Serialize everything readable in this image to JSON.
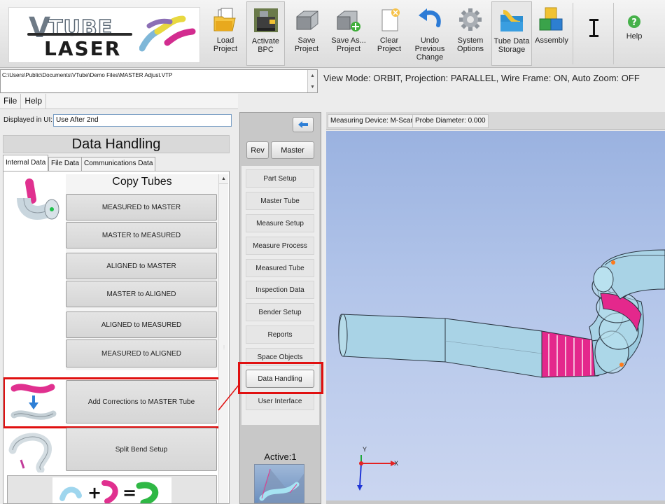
{
  "toolbar": {
    "logo": "VTUBE LASER",
    "buttons": [
      {
        "label": "Load Project",
        "icon": "folder-open-icon"
      },
      {
        "label": "Activate BPC",
        "icon": "bender-machine-icon"
      },
      {
        "label": "Save Project",
        "icon": "save-disk-icon"
      },
      {
        "label": "Save As... Project",
        "icon": "save-as-icon"
      },
      {
        "label": "Clear Project",
        "icon": "clear-document-icon"
      },
      {
        "label": "Undo Previous Change",
        "icon": "undo-arrow-icon"
      },
      {
        "label": "System Options",
        "icon": "gear-icon"
      },
      {
        "label": "Tube Data Storage",
        "icon": "tube-folder-icon"
      },
      {
        "label": "Assembly",
        "icon": "cubes-icon"
      },
      {
        "label": "",
        "icon": "text-cursor-icon"
      },
      {
        "label": "Help",
        "icon": "help-icon"
      }
    ]
  },
  "file_path": "C:\\Users\\Public\\Documents\\VTube\\Demo Files\\MASTER Adjust.VTP",
  "view_mode": "View Mode: ORBIT, Projection: PARALLEL, Wire Frame: ON, Auto Zoom: OFF",
  "menu": {
    "file": "File",
    "help": "Help"
  },
  "displayed_in_ui": {
    "label": "Displayed in UI:",
    "value": "Use After 2nd"
  },
  "panel": {
    "title": "Data Handling",
    "tabs": [
      "Internal Data",
      "File Data",
      "Communications Data"
    ],
    "copy_title": "Copy Tubes",
    "copy_buttons": [
      "MEASURED to MASTER",
      "MASTER to MEASURED",
      "ALIGNED to MASTER",
      "MASTER to ALIGNED",
      "ALIGNED to MEASURED",
      "MEASURED to ALIGNED"
    ],
    "add_corrections": "Add Corrections to MASTER Tube",
    "split_bend": "Split Bend Setup"
  },
  "nav": {
    "rev": "Rev",
    "master": "Master",
    "items": [
      "Part Setup",
      "Master Tube",
      "Measure Setup",
      "Measure Process",
      "Measured Tube",
      "Inspection Data",
      "Bender Setup",
      "Reports",
      "Space Objects",
      "Data Handling",
      "User Interface"
    ],
    "selected": "Data Handling",
    "active": "Active:1"
  },
  "device": {
    "measuring": "Measuring Device: M-Scan",
    "probe": "Probe Diameter: 0.000"
  },
  "axes": {
    "x": "X",
    "y": "Y"
  },
  "colors": {
    "highlight": "#e01010",
    "tube": "#a9d3e6",
    "correction": "#e4288c",
    "viewport_top": "#9ab2e0",
    "viewport_bottom": "#cbd6f0"
  }
}
